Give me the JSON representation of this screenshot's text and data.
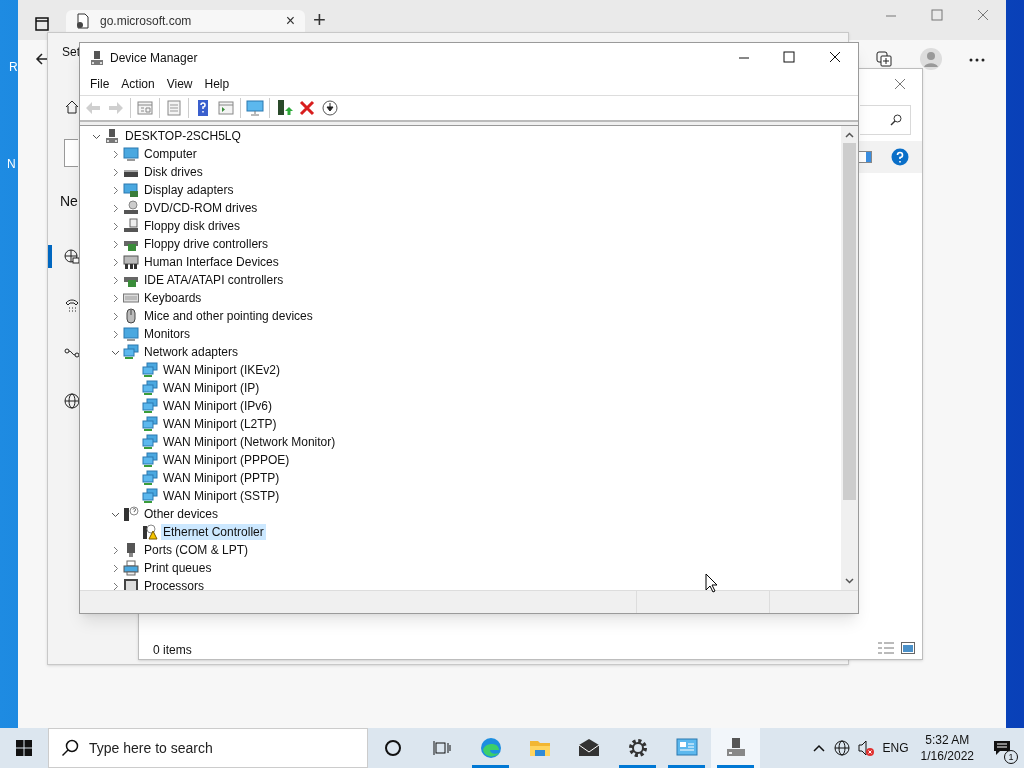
{
  "desktop": {
    "icon_labels": [
      "R",
      "N"
    ]
  },
  "browser": {
    "tab": {
      "title": "go.microsoft.com",
      "close": "×"
    },
    "new_tab": "+"
  },
  "settings_window": {
    "title": "Set",
    "heading": "Ne",
    "nav_items": [
      {
        "kind": "ethernet",
        "selected": true
      },
      {
        "kind": "dialup",
        "selected": false
      },
      {
        "kind": "vpn",
        "selected": false
      },
      {
        "kind": "proxy",
        "selected": false
      }
    ]
  },
  "explorer_window": {
    "status": "0 items"
  },
  "device_manager": {
    "title": "Device Manager",
    "menu": [
      "File",
      "Action",
      "View",
      "Help"
    ],
    "toolbar": [
      {
        "kind": "back",
        "disabled": true
      },
      {
        "kind": "forward",
        "disabled": true
      },
      {
        "kind": "properties",
        "disabled": false
      },
      {
        "kind": "list",
        "disabled": false
      },
      {
        "kind": "help",
        "disabled": false
      },
      {
        "kind": "view",
        "disabled": false
      },
      {
        "kind": "scan",
        "disabled": false
      },
      {
        "kind": "update",
        "disabled": false
      },
      {
        "kind": "remove",
        "disabled": false
      },
      {
        "kind": "disable",
        "disabled": false
      }
    ],
    "tree": {
      "label": "DESKTOP-2SCH5LQ",
      "kind": "pc",
      "expanded": true,
      "selected": false,
      "children": [
        {
          "label": "Computer",
          "kind": "computer",
          "expanded": false,
          "selected": false
        },
        {
          "label": "Disk drives",
          "kind": "disk",
          "expanded": false,
          "selected": false
        },
        {
          "label": "Display adapters",
          "kind": "display",
          "expanded": false,
          "selected": false
        },
        {
          "label": "DVD/CD-ROM drives",
          "kind": "dvd",
          "expanded": false,
          "selected": false
        },
        {
          "label": "Floppy disk drives",
          "kind": "floppy",
          "expanded": false,
          "selected": false
        },
        {
          "label": "Floppy drive controllers",
          "kind": "controller",
          "expanded": false,
          "selected": false
        },
        {
          "label": "Human Interface Devices",
          "kind": "hid",
          "expanded": false,
          "selected": false
        },
        {
          "label": "IDE ATA/ATAPI controllers",
          "kind": "controller",
          "expanded": false,
          "selected": false
        },
        {
          "label": "Keyboards",
          "kind": "keyboard",
          "expanded": false,
          "selected": false
        },
        {
          "label": "Mice and other pointing devices",
          "kind": "mouse",
          "expanded": false,
          "selected": false
        },
        {
          "label": "Monitors",
          "kind": "monitor",
          "expanded": false,
          "selected": false
        },
        {
          "label": "Network adapters",
          "kind": "network",
          "expanded": true,
          "selected": false,
          "children": [
            {
              "label": "WAN Miniport (IKEv2)",
              "kind": "network",
              "selected": false
            },
            {
              "label": "WAN Miniport (IP)",
              "kind": "network",
              "selected": false
            },
            {
              "label": "WAN Miniport (IPv6)",
              "kind": "network",
              "selected": false
            },
            {
              "label": "WAN Miniport (L2TP)",
              "kind": "network",
              "selected": false
            },
            {
              "label": "WAN Miniport (Network Monitor)",
              "kind": "network",
              "selected": false
            },
            {
              "label": "WAN Miniport (PPPOE)",
              "kind": "network",
              "selected": false
            },
            {
              "label": "WAN Miniport (PPTP)",
              "kind": "network",
              "selected": false
            },
            {
              "label": "WAN Miniport (SSTP)",
              "kind": "network",
              "selected": false
            }
          ]
        },
        {
          "label": "Other devices",
          "kind": "unknown",
          "expanded": true,
          "selected": false,
          "children": [
            {
              "label": "Ethernet Controller",
              "kind": "warning",
              "selected": true
            }
          ]
        },
        {
          "label": "Ports (COM & LPT)",
          "kind": "port",
          "expanded": false,
          "selected": false
        },
        {
          "label": "Print queues",
          "kind": "printer",
          "expanded": false,
          "selected": false
        },
        {
          "label": "Processors",
          "kind": "processor",
          "expanded": false,
          "selected": false
        }
      ]
    }
  },
  "taskbar": {
    "search_placeholder": "Type here to search",
    "apps": [
      {
        "kind": "cortana",
        "running": false,
        "selected": false
      },
      {
        "kind": "taskview",
        "running": false,
        "selected": false
      },
      {
        "kind": "edge",
        "running": true,
        "selected": false
      },
      {
        "kind": "explorer",
        "running": false,
        "selected": false
      },
      {
        "kind": "mail",
        "running": false,
        "selected": false
      },
      {
        "kind": "settings",
        "running": true,
        "selected": false
      },
      {
        "kind": "controlpanel",
        "running": true,
        "selected": false
      },
      {
        "kind": "devmgr",
        "running": true,
        "selected": true
      }
    ],
    "language": "ENG",
    "time": "5:32 AM",
    "date": "1/16/2022",
    "notification_count": "1"
  }
}
